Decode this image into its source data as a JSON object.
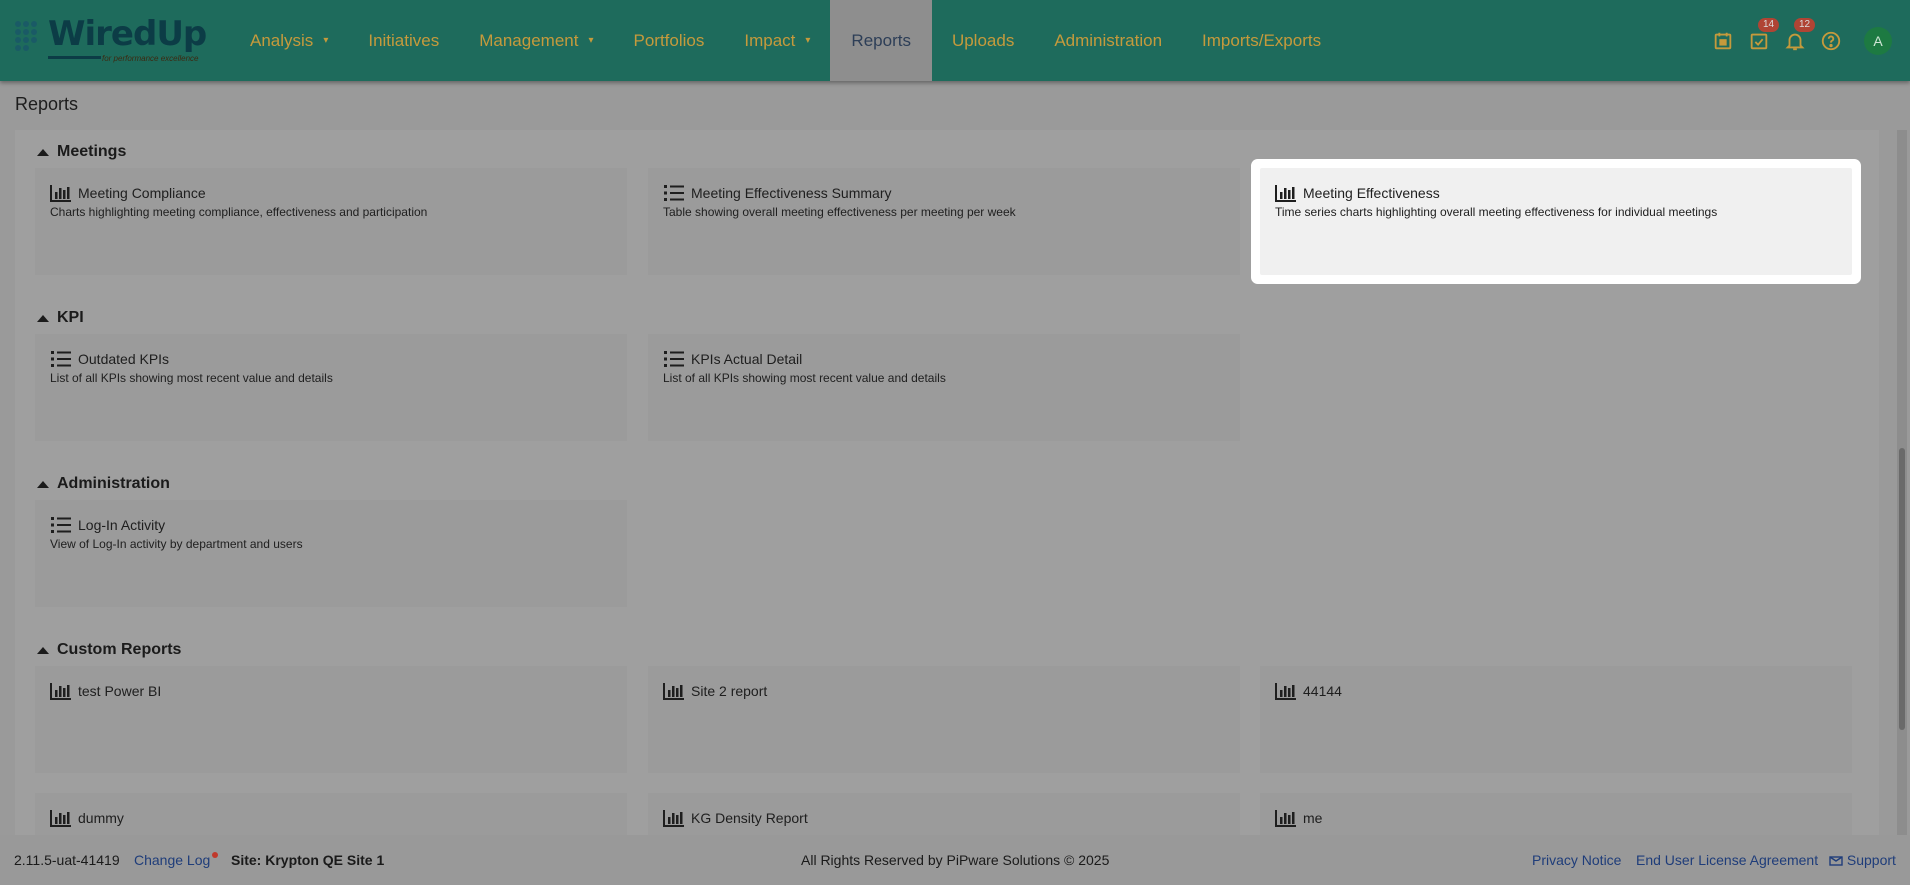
{
  "brand": {
    "name": "WiredUp",
    "tagline": "for performance excellence"
  },
  "nav": {
    "items": [
      {
        "label": "Analysis",
        "has_dropdown": true
      },
      {
        "label": "Initiatives",
        "has_dropdown": false
      },
      {
        "label": "Management",
        "has_dropdown": true
      },
      {
        "label": "Portfolios",
        "has_dropdown": false
      },
      {
        "label": "Impact",
        "has_dropdown": true
      },
      {
        "label": "Reports",
        "active": true
      },
      {
        "label": "Uploads"
      },
      {
        "label": "Administration"
      },
      {
        "label": "Imports/Exports"
      }
    ],
    "caret": "▾"
  },
  "toolbar": {
    "calendar_icon": "calendar-icon",
    "tasks_icon": "task-check-icon",
    "tasks_badge": "14",
    "notifications_icon": "bell-icon",
    "notifications_badge": "12",
    "help_icon": "help-circle-icon",
    "avatar_initial": "A"
  },
  "page": {
    "title": "Reports"
  },
  "sections": [
    {
      "title": "Meetings",
      "cards": [
        {
          "icon": "bar-chart-icon",
          "title": "Meeting Compliance",
          "desc": "Charts highlighting meeting compliance, effectiveness and participation"
        },
        {
          "icon": "list-icon",
          "title": "Meeting Effectiveness Summary",
          "desc": "Table showing overall meeting effectiveness per meeting per week"
        },
        {
          "icon": "bar-chart-icon",
          "title": "Meeting Effectiveness",
          "desc": "Time series charts highlighting overall meeting effectiveness for individual meetings",
          "highlighted": true
        }
      ]
    },
    {
      "title": "KPI",
      "cards": [
        {
          "icon": "list-icon",
          "title": "Outdated KPIs",
          "desc": "List of all KPIs showing most recent value and details"
        },
        {
          "icon": "list-icon",
          "title": "KPIs Actual Detail",
          "desc": "List of all KPIs showing most recent value and details"
        }
      ]
    },
    {
      "title": "Administration",
      "cards": [
        {
          "icon": "list-icon",
          "title": "Log-In Activity",
          "desc": "View of Log-In activity by department and users"
        }
      ]
    },
    {
      "title": "Custom Reports",
      "cards": [
        {
          "icon": "bar-chart-icon",
          "title": "test Power BI",
          "desc": ""
        },
        {
          "icon": "bar-chart-icon",
          "title": "Site 2 report",
          "desc": ""
        },
        {
          "icon": "bar-chart-icon",
          "title": "44144",
          "desc": ""
        },
        {
          "icon": "bar-chart-icon",
          "title": "dummy",
          "desc": ""
        },
        {
          "icon": "bar-chart-icon",
          "title": "KG Density Report",
          "desc": ""
        },
        {
          "icon": "bar-chart-icon",
          "title": "me",
          "desc": ""
        }
      ]
    }
  ],
  "footer": {
    "version": "2.11.5-uat-41419",
    "changelog": "Change Log",
    "site": "Site: Krypton QE Site 1",
    "copyright": "All Rights Reserved by PiPware Solutions © 2025",
    "privacy": "Privacy Notice",
    "eula": "End User License Agreement",
    "support": "Support"
  }
}
